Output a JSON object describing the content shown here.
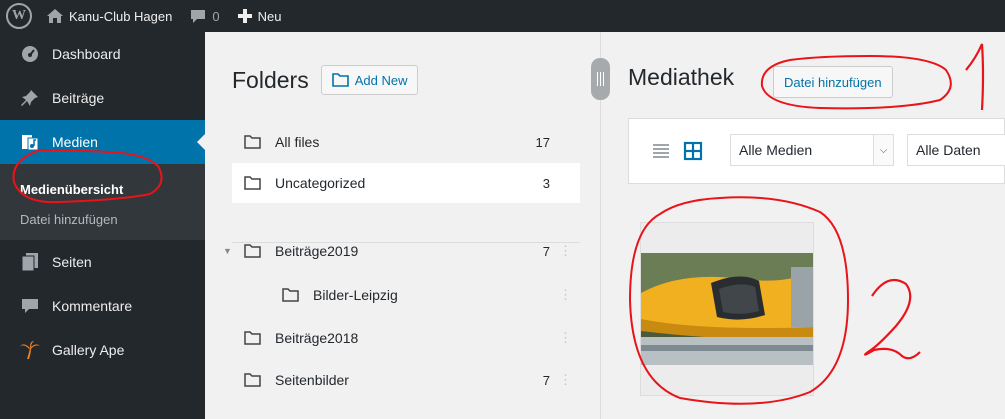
{
  "adminbar": {
    "wp_logo": "W",
    "site_name": "Kanu-Club Hagen",
    "comments_count": "0",
    "new_label": "Neu",
    "icons": [
      "wordpress-icon",
      "home-icon",
      "comment-icon",
      "plus-icon"
    ]
  },
  "sidebar": {
    "items": [
      {
        "label": "Dashboard",
        "icon": "dashboard-icon"
      },
      {
        "label": "Beiträge",
        "icon": "pin-icon"
      },
      {
        "label": "Medien",
        "icon": "media-icon"
      },
      {
        "label": "Seiten",
        "icon": "page-icon"
      },
      {
        "label": "Kommentare",
        "icon": "comment-icon"
      },
      {
        "label": "Gallery Ape",
        "icon": "palm-icon"
      }
    ],
    "submenu": [
      {
        "label": "Medienübersicht"
      },
      {
        "label": "Datei hinzufügen"
      }
    ]
  },
  "folders": {
    "title": "Folders",
    "add_new": "Add New",
    "rows": [
      {
        "label": "All files",
        "count": "17"
      },
      {
        "label": "Uncategorized",
        "count": "3"
      },
      {
        "label": "Beiträge2019",
        "count": "7"
      },
      {
        "label": "Bilder-Leipzig",
        "count": ""
      },
      {
        "label": "Beiträge2018",
        "count": ""
      },
      {
        "label": "Seitenbilder",
        "count": "7"
      }
    ]
  },
  "media": {
    "title": "Mediathek",
    "upload_button": "Datei hinzufügen",
    "filter_type": "Alle Medien",
    "filter_date": "Alle Daten"
  },
  "annotations": {
    "mark_1": "1",
    "mark_2": "2"
  },
  "colors": {
    "adminbar_bg": "#23282d",
    "sidebar_bg": "#23282d",
    "active_bg": "#0073aa",
    "accent": "#0073aa",
    "annotation_red": "#e8141a"
  }
}
